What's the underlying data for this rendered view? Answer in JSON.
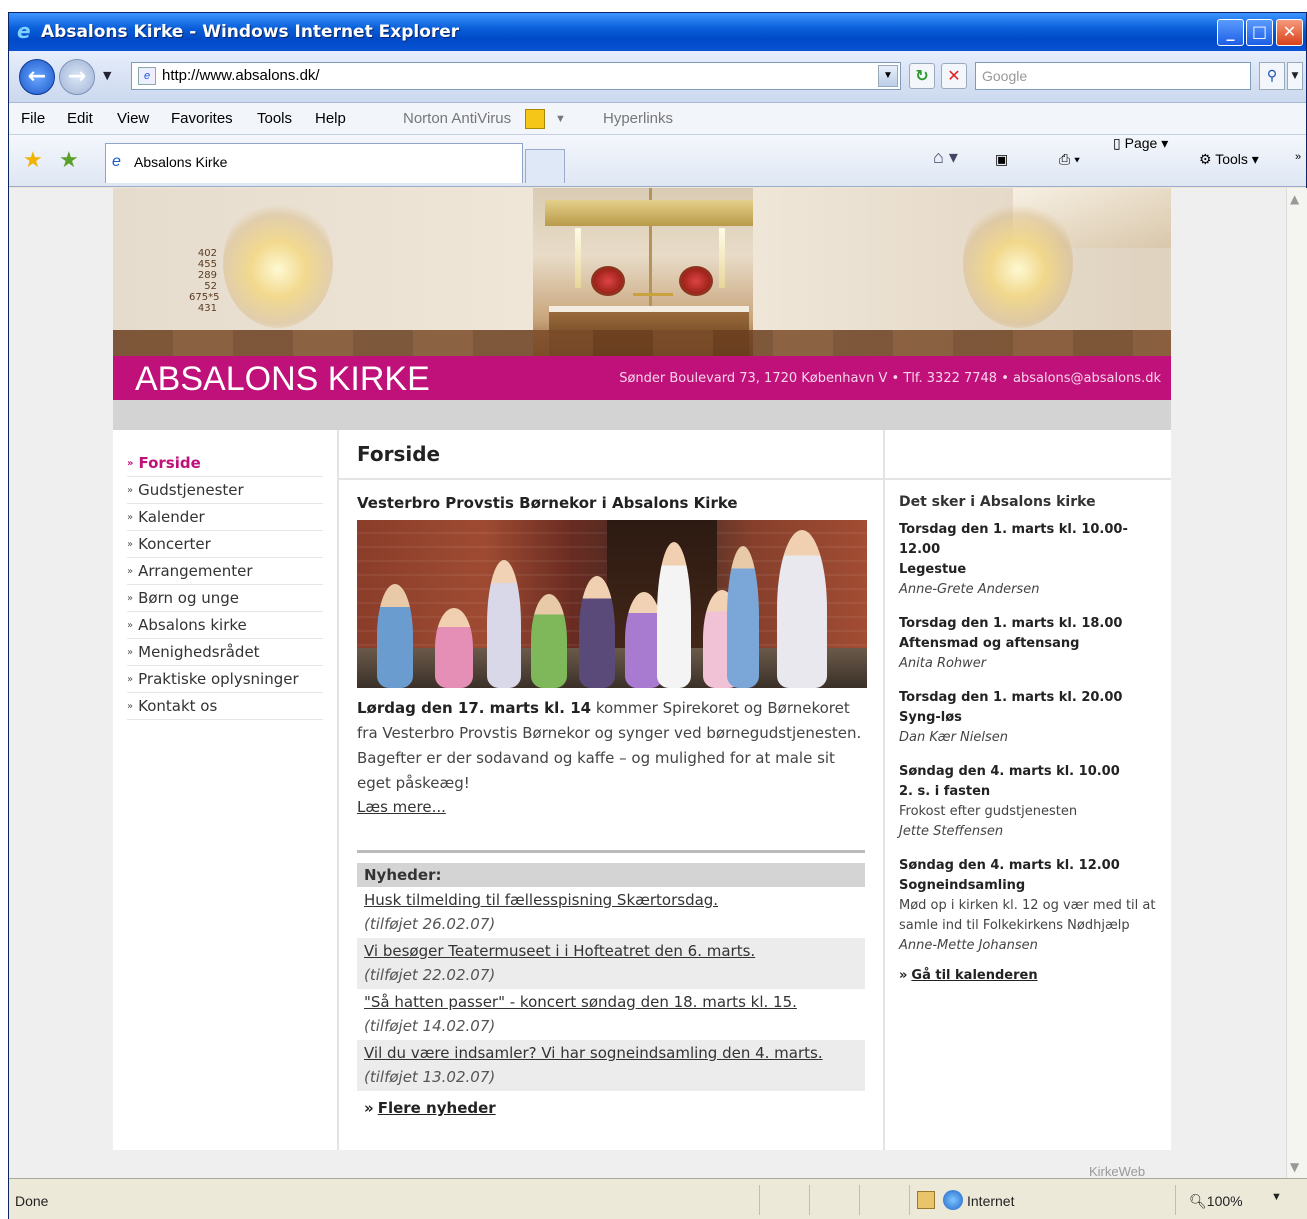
{
  "window": {
    "title": "Absalons Kirke - Windows Internet Explorer",
    "minimize": "_",
    "maximize": "□",
    "close": "✕"
  },
  "address_bar": {
    "url": "http://www.absalons.dk/",
    "search_placeholder": "Google"
  },
  "menu": {
    "items": [
      "File",
      "Edit",
      "View",
      "Favorites",
      "Tools",
      "Help"
    ],
    "addons": [
      "Norton AntiVirus",
      "Hyperlinks"
    ]
  },
  "tabs": {
    "active_label": "Absalons Kirke"
  },
  "command_bar": {
    "page": "Page",
    "tools": "Tools",
    "more": "»"
  },
  "site": {
    "name": "ABSALONS KIRKE",
    "address_line": "Sønder Boulevard 73, 1720 København V • Tlf. 3322 7748 • absalons@absalons.dk",
    "hymn_numbers": [
      "402",
      "455",
      "289",
      "",
      "52",
      "675*5",
      "431"
    ],
    "footer_credit": "KirkeWeb",
    "nav": [
      {
        "label": "Forside",
        "active": true
      },
      {
        "label": "Gudstjenester",
        "active": false
      },
      {
        "label": "Kalender",
        "active": false
      },
      {
        "label": "Koncerter",
        "active": false
      },
      {
        "label": "Arrangementer",
        "active": false
      },
      {
        "label": "Børn og unge",
        "active": false
      },
      {
        "label": "Absalons kirke",
        "active": false
      },
      {
        "label": "Menighedsrådet",
        "active": false
      },
      {
        "label": "Praktiske oplysninger",
        "active": false
      },
      {
        "label": "Kontakt os",
        "active": false
      }
    ]
  },
  "main": {
    "page_title": "Forside",
    "headline": "Vesterbro Provstis Børnekor i Absalons Kirke",
    "lead_bold": "Lørdag den 17. marts kl. 14",
    "lead_rest": " kommer Spirekoret og Børnekoret fra Vesterbro Provstis Børnekor og synger ved børnegudstjenesten. Bagefter er der sodavand og kaffe – og mulighed for at male sit eget påskeæg!",
    "read_more": "Læs mere...",
    "news_heading": "Nyheder:",
    "news": [
      {
        "title": "Husk tilmelding til fællesspisning Skærtorsdag.",
        "date": "(tilføjet 26.02.07)"
      },
      {
        "title": "Vi besøger Teatermuseet i i Hofteatret den 6. marts.",
        "date": "(tilføjet 22.02.07)"
      },
      {
        "title": "\"Så hatten passer\" - koncert søndag den 18. marts kl. 15.",
        "date": "(tilføjet 14.02.07)"
      },
      {
        "title": "Vil du være indsamler? Vi har sogneindsamling den 4. marts.",
        "date": "(tilføjet 13.02.07)"
      }
    ],
    "more_news": "Flere nyheder"
  },
  "sidebar": {
    "heading": "Det sker i Absalons kirke",
    "events": [
      {
        "when": "Torsdag den 1. marts kl. 10.00-12.00",
        "what": "Legestue",
        "note": "",
        "who": "Anne-Grete Andersen"
      },
      {
        "when": "Torsdag den 1. marts kl. 18.00",
        "what": "Aftensmad og aftensang",
        "note": "",
        "who": "Anita Rohwer"
      },
      {
        "when": "Torsdag den 1. marts kl. 20.00",
        "what": "Syng-løs",
        "note": "",
        "who": "Dan Kær Nielsen"
      },
      {
        "when": "Søndag den 4. marts kl. 10.00",
        "what": "2. s. i fasten",
        "note": "Frokost efter gudstjenesten",
        "who": "Jette Steffensen"
      },
      {
        "when": "Søndag den 4. marts kl. 12.00",
        "what": "Sogneindsamling",
        "note": "Mød op i kirken kl. 12 og vær med til at samle ind til Folkekirkens Nødhjælp",
        "who": "Anne-Mette Johansen"
      }
    ],
    "calendar_link": "Gå til kalenderen"
  },
  "status": {
    "text": "Done",
    "zone": "Internet",
    "zoom": "100%"
  },
  "colors": {
    "brand": "#c0107a",
    "titlebar": "#0a5fd8"
  }
}
